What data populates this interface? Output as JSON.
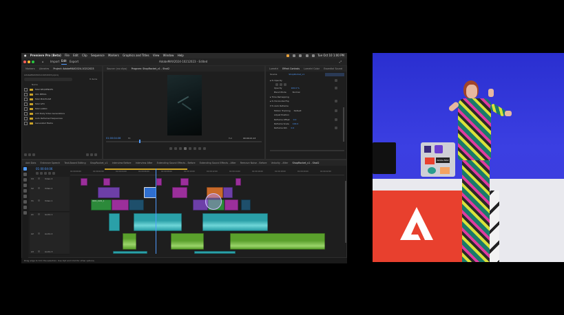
{
  "menubar": {
    "app_name": "Premiere Pro (Beta)",
    "items": [
      "File",
      "Edit",
      "Clip",
      "Sequence",
      "Markers",
      "Graphics and Titles",
      "View",
      "Window",
      "Help"
    ],
    "clock": "Tue Oct 10  1:00 PM"
  },
  "titlebar": {
    "nav": [
      "Import",
      "Edit",
      "Export"
    ],
    "document_title": "AdobeMAX2024-10212023 - Edited"
  },
  "project_panel": {
    "tabs": [
      "Markers",
      "Libraries",
      "Project: AdobeMAX2024-10212023",
      "Source: (no clips)"
    ],
    "project_file": "AdobeMAX2024-10212023.prproj",
    "item_count": "8 items",
    "column_name": "Name",
    "bins": [
      "MAX SEQUENCES",
      "001 MEDIA",
      "MAX MULTICAM",
      "MAX GFX",
      "MAX AUDIO",
      "Add Daily Video Generations",
      "Auto Reframed Sequences",
      "Generated Media"
    ]
  },
  "program_monitor": {
    "tab": "Program: ShopRocket_v1 - Shot2",
    "timecode_left": "01:00:04:06",
    "fit": "Fit",
    "quality": "Full",
    "timecode_right": "00:00:21:13"
  },
  "effect_controls": {
    "tabs": [
      "Lumetri",
      "Effect Controls",
      "Lumetri Color",
      "Essential Sound"
    ],
    "source_label": "Source",
    "clip_label": "ShopRocket_v1",
    "rows": [
      "Opacity",
      "Opacity",
      "Blend Mode",
      "Time Remapping",
      "Horizontal Flip",
      "Auto Reframe",
      "Motion Tracking",
      "Adjust Position",
      "Reframe Offset",
      "Reframe Scale",
      "Reframe Rot."
    ],
    "values": {
      "opacity": "100.0 %",
      "blend": "Normal",
      "tracking": "Default",
      "offset": "0.0",
      "scale": "100.0",
      "rotation": "0.0"
    }
  },
  "timeline": {
    "tabs": [
      "Add Dots",
      "Entrance Speech",
      "Text-Based Editing",
      "ShopRocket_v1",
      "Interview Before",
      "Interview After",
      "Extending Sound Effects - Before",
      "Extending Sound Effects - After",
      "Remove Noise - Before",
      "Velocity - After",
      "ShopRocket_v1 - Shot2"
    ],
    "playhead": "01:00:04:06",
    "ruler": [
      "01:00:00:00",
      "01:00:02:00",
      "01:00:04:00",
      "01:00:06:00",
      "01:00:08:00",
      "01:00:10:00",
      "01:00:12:00",
      "01:00:14:00",
      "01:00:16:00",
      "01:00:18:00",
      "01:00:20:00",
      "01:00:22:00"
    ],
    "video_tracks": [
      "Video 3",
      "Video 2",
      "Video 1"
    ],
    "audio_tracks": [
      "Audio 1",
      "Audio 2",
      "Audio 3"
    ],
    "track_ids": [
      "V3",
      "V2",
      "V1",
      "A1",
      "A2",
      "A3"
    ],
    "clip_label": "0001_4181_1",
    "status_bar": "Drag edge to trim the selection. Use Opt and Cmd for other options."
  },
  "stage": {
    "logo_letter": "A",
    "laptop_sticker": "Adobe MAX"
  },
  "colors": {
    "accent": "#4f9bff",
    "video_clip_purple": "#9b2f9b",
    "video_clip_green": "#2c8a3a",
    "audio_teal": "#2aa0a8",
    "audio_green": "#5aa02c",
    "adobe_red": "#e8402e",
    "stage_blue": "#3a3fe0"
  }
}
